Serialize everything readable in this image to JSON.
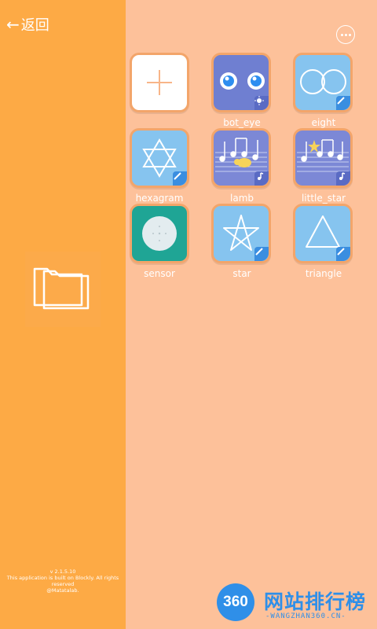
{
  "header": {
    "back_label": "返回",
    "back_icon": "arrow-left-icon",
    "more_icon": "more-dots-icon"
  },
  "sidebar": {
    "folder_icon": "folder-icon",
    "version": "v 2.1.5.10",
    "notice": "This application is built on Blockly. All rights reserved",
    "author": "@Matatalab."
  },
  "projects": [
    {
      "label": "",
      "type": "new",
      "icon": "plus-icon"
    },
    {
      "label": "bot_eye",
      "type": "light",
      "icon": "eyes-icon"
    },
    {
      "label": "eight",
      "type": "draw",
      "icon": "figure-eight-icon"
    },
    {
      "label": "hexagram",
      "type": "draw",
      "icon": "hexagram-icon"
    },
    {
      "label": "lamb",
      "type": "music",
      "icon": "music-lamb-icon"
    },
    {
      "label": "little_star",
      "type": "music",
      "icon": "music-star-icon"
    },
    {
      "label": "sensor",
      "type": "sensor",
      "icon": "sensor-icon"
    },
    {
      "label": "star",
      "type": "draw",
      "icon": "star-icon"
    },
    {
      "label": "triangle",
      "type": "draw",
      "icon": "triangle-icon"
    }
  ],
  "watermark": {
    "number": "360",
    "title": "网站排行榜",
    "sub": "-WANGZHAN360.CN-"
  },
  "colors": {
    "sidebar": "#fdaa45",
    "background": "#fdc19a",
    "tile_border": "#f3a56a",
    "blue_tile": "#86c4ef",
    "purple_tile": "#6f7fd1",
    "teal_tile": "#1fa595"
  }
}
